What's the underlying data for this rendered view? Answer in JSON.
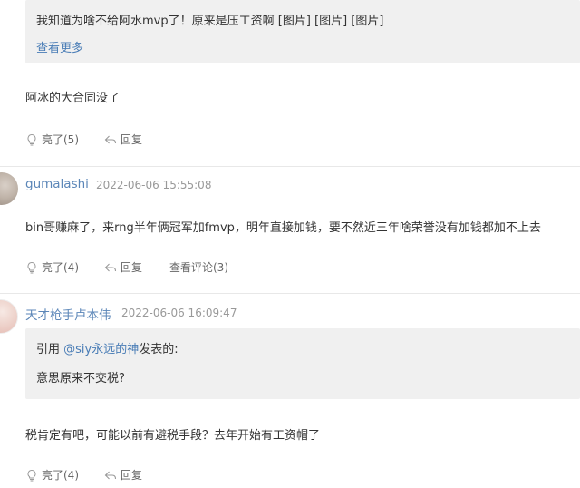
{
  "posts": [
    {
      "quote_text": "我知道为啥不给阿水mvp了！原来是压工资啊 [图片] [图片] [图片]",
      "quote_more": "查看更多",
      "content": "阿冰的大合同没了",
      "like": "亮了(5)",
      "reply": "回复"
    },
    {
      "username": "gumalashi",
      "time": "2022-06-06 15:55:08",
      "content": "bin哥赚麻了，来rng半年俩冠军加fmvp，明年直接加钱，要不然近三年啥荣誉没有加钱都加不上去",
      "like": "亮了(4)",
      "reply": "回复",
      "view_comments": "查看评论(3)"
    },
    {
      "username": "天才枪手卢本伟",
      "time": "2022-06-06 16:09:47",
      "quote_prefix": "引用",
      "quote_user": "@siy永远的神",
      "quote_suffix": "发表的:",
      "quote_text": "意思原来不交税?",
      "content": "税肯定有吧，可能以前有避税手段？去年开始有工资帽了",
      "like": "亮了(4)",
      "reply": "回复"
    }
  ],
  "icons": {
    "like": "lightbulb-icon",
    "reply": "reply-arrow-icon"
  },
  "colors": {
    "link": "#4a7db6",
    "quote_bg": "#f0f0f0",
    "divider": "#e8e8e8"
  }
}
